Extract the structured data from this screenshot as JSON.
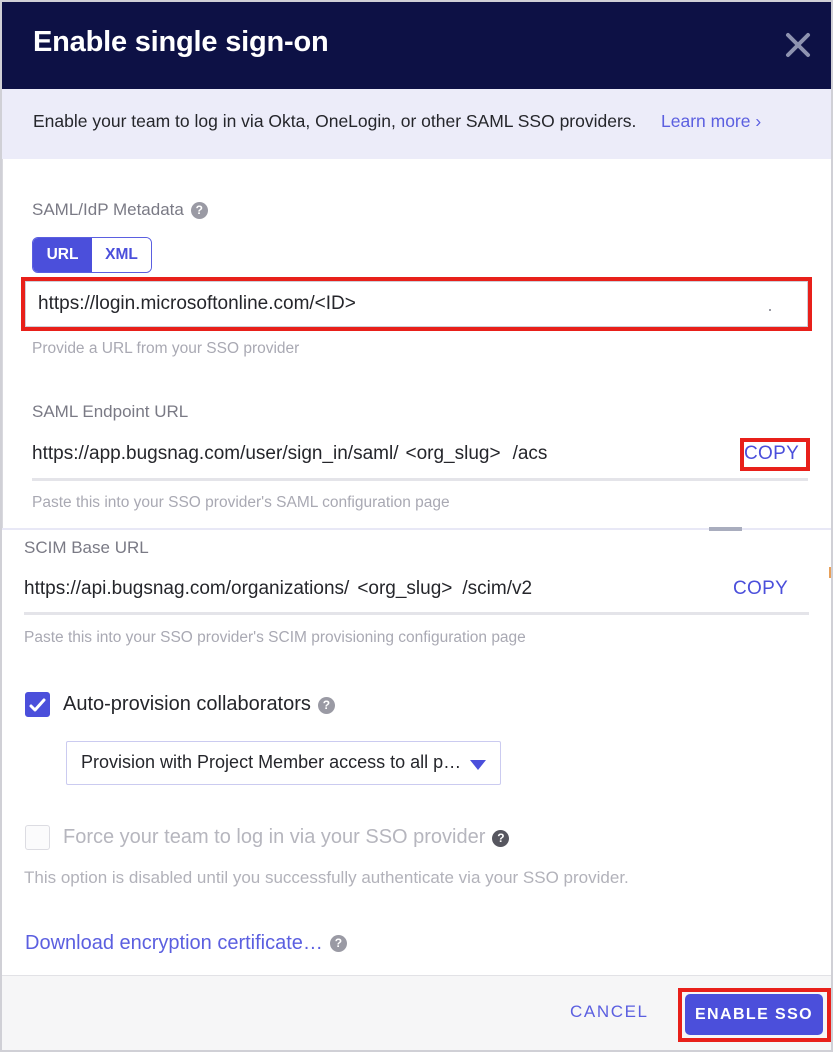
{
  "dialog": {
    "title": "Enable single sign-on",
    "close_icon": "close-icon"
  },
  "banner": {
    "text": "Enable your team to log in via Okta, OneLogin, or other SAML SSO providers.",
    "link": "Learn more ›"
  },
  "metadata": {
    "label": "SAML/IdP Metadata",
    "help_icon": "?",
    "tabs": [
      {
        "label": "URL",
        "active": true
      },
      {
        "label": "XML",
        "active": false
      }
    ],
    "input_value": "https://login.microsoftonline.com/<ID>",
    "helper": "Provide a URL from your SSO provider"
  },
  "saml_endpoint": {
    "label": "SAML Endpoint URL",
    "prefix": "https://app.bugsnag.com/user/sign_in/saml/",
    "slug": "<org_slug>",
    "suffix": "/acs",
    "copy_label": "COPY",
    "helper": "Paste this into your SSO provider's SAML configuration page"
  },
  "scim_base": {
    "label": "SCIM Base URL",
    "prefix": "https://api.bugsnag.com/organizations/",
    "slug": "<org_slug>",
    "suffix": "/scim/v2",
    "copy_label": "COPY",
    "helper": "Paste this into your SSO provider's SCIM provisioning configuration page"
  },
  "auto_provision": {
    "label": "Auto-provision collaborators",
    "checked": true,
    "help_icon": "?",
    "select_value": "Provision with Project Member access to all p…"
  },
  "force_sso": {
    "label": "Force your team to log in via your SSO provider",
    "checked": false,
    "disabled": true,
    "help_icon": "?",
    "note": "This option is disabled until you successfully authenticate via your SSO provider."
  },
  "download_certificate": {
    "label": "Download encryption certificate…",
    "help_icon": "?"
  },
  "footer": {
    "cancel_label": "CANCEL",
    "enable_label": "ENABLE SSO"
  },
  "colors": {
    "header_bg": "#0d1145",
    "banner_bg": "#ececf9",
    "accent": "#4b4fdb",
    "link": "#5b5fe0",
    "annotation": "#e8201a",
    "footer_bg": "#f6f6f7",
    "muted_text": "#a9a9b3"
  }
}
